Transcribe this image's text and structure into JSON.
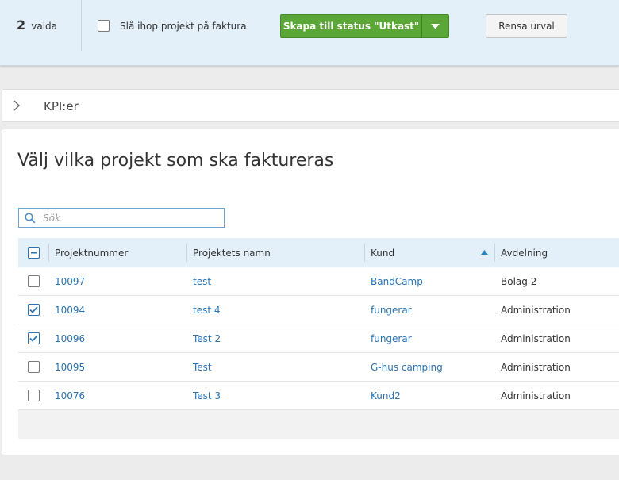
{
  "selection_bar": {
    "count": "2",
    "count_label": "valda",
    "merge_label": "Slå ihop projekt på faktura",
    "create_button": "Skapa till status \"Utkast\"",
    "clear_button": "Rensa urval"
  },
  "kpi": {
    "title": "KPI:er"
  },
  "main": {
    "title": "Välj vilka projekt som ska faktureras",
    "search_placeholder": "Sök",
    "columns": {
      "project_number": "Projektnummer",
      "project_name": "Projektets namn",
      "customer": "Kund",
      "department": "Avdelning"
    },
    "rows": [
      {
        "checked": false,
        "number": "10097",
        "name": "test",
        "customer": "BandCamp",
        "department": "Bolag 2"
      },
      {
        "checked": true,
        "number": "10094",
        "name": "test 4",
        "customer": "fungerar",
        "department": "Administration"
      },
      {
        "checked": true,
        "number": "10096",
        "name": "Test 2",
        "customer": "fungerar",
        "department": "Administration"
      },
      {
        "checked": false,
        "number": "10095",
        "name": "Test",
        "customer": "G-hus camping",
        "department": "Administration"
      },
      {
        "checked": false,
        "number": "10076",
        "name": "Test 3",
        "customer": "Kund2",
        "department": "Administration"
      }
    ]
  },
  "icons": {
    "chevron": "chevron-right-icon",
    "search": "search-icon",
    "dropdown": "caret-down-icon",
    "sort": "sort-ascending-icon",
    "header_checkbox": "minus-checkbox-icon",
    "checkmark": "checkmark-icon"
  },
  "colors": {
    "primary_green": "#5aa636",
    "link_blue": "#2a73b0",
    "header_bg": "#e3f0fa",
    "checkbox_blue": "#2a73b0"
  }
}
